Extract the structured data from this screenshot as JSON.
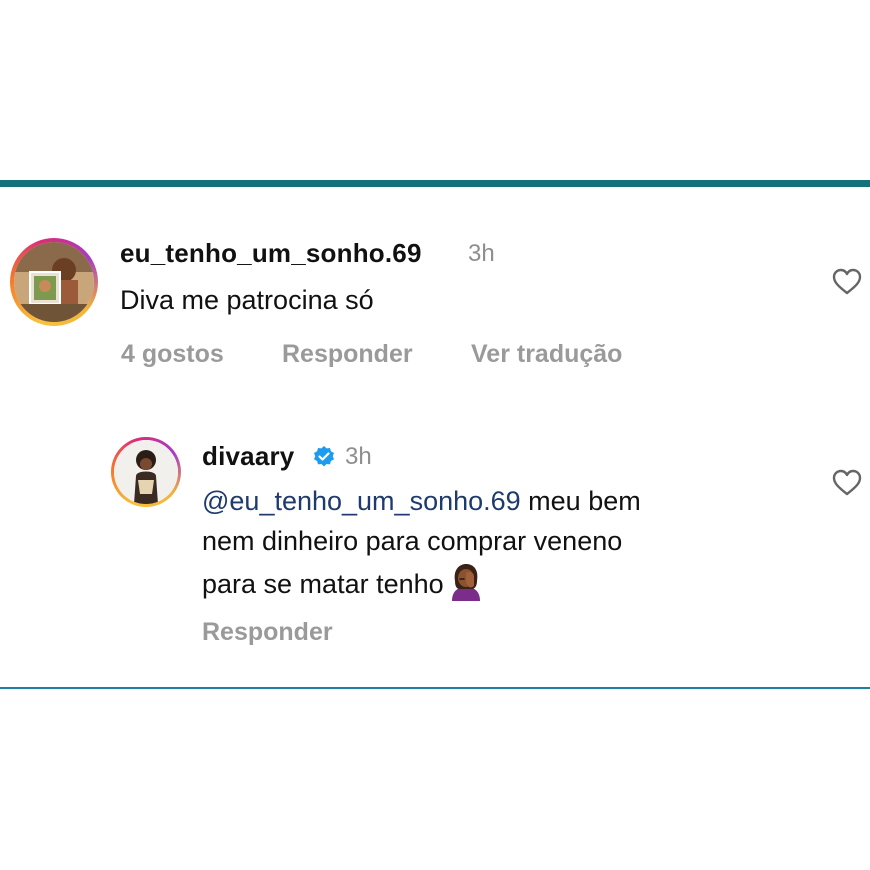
{
  "colors": {
    "accent_bar_top": "#16727a",
    "accent_bar_bottom": "#1f7fa0",
    "mention": "#1e3a6e",
    "muted": "#8e8e8e"
  },
  "comment": {
    "username": "eu_tenho_um_sonho.69",
    "time": "3h",
    "text": "Diva me patrocina só",
    "likes_label": "4 gostos",
    "reply_label": "Responder",
    "translate_label": "Ver tradução",
    "avatar_icon": "profile-photo-icon",
    "like_icon": "heart-outline-icon"
  },
  "reply": {
    "username": "divaary",
    "verified_icon": "verified-badge-icon",
    "time": "3h",
    "mention": "@eu_tenho_um_sonho.69",
    "text_line1": " meu bem",
    "text_line2": "nem dinheiro para comprar veneno",
    "text_line3": "para se matar tenho",
    "emoji": "woman-facepalming-emoji",
    "reply_label": "Responder",
    "like_icon": "heart-outline-icon"
  }
}
